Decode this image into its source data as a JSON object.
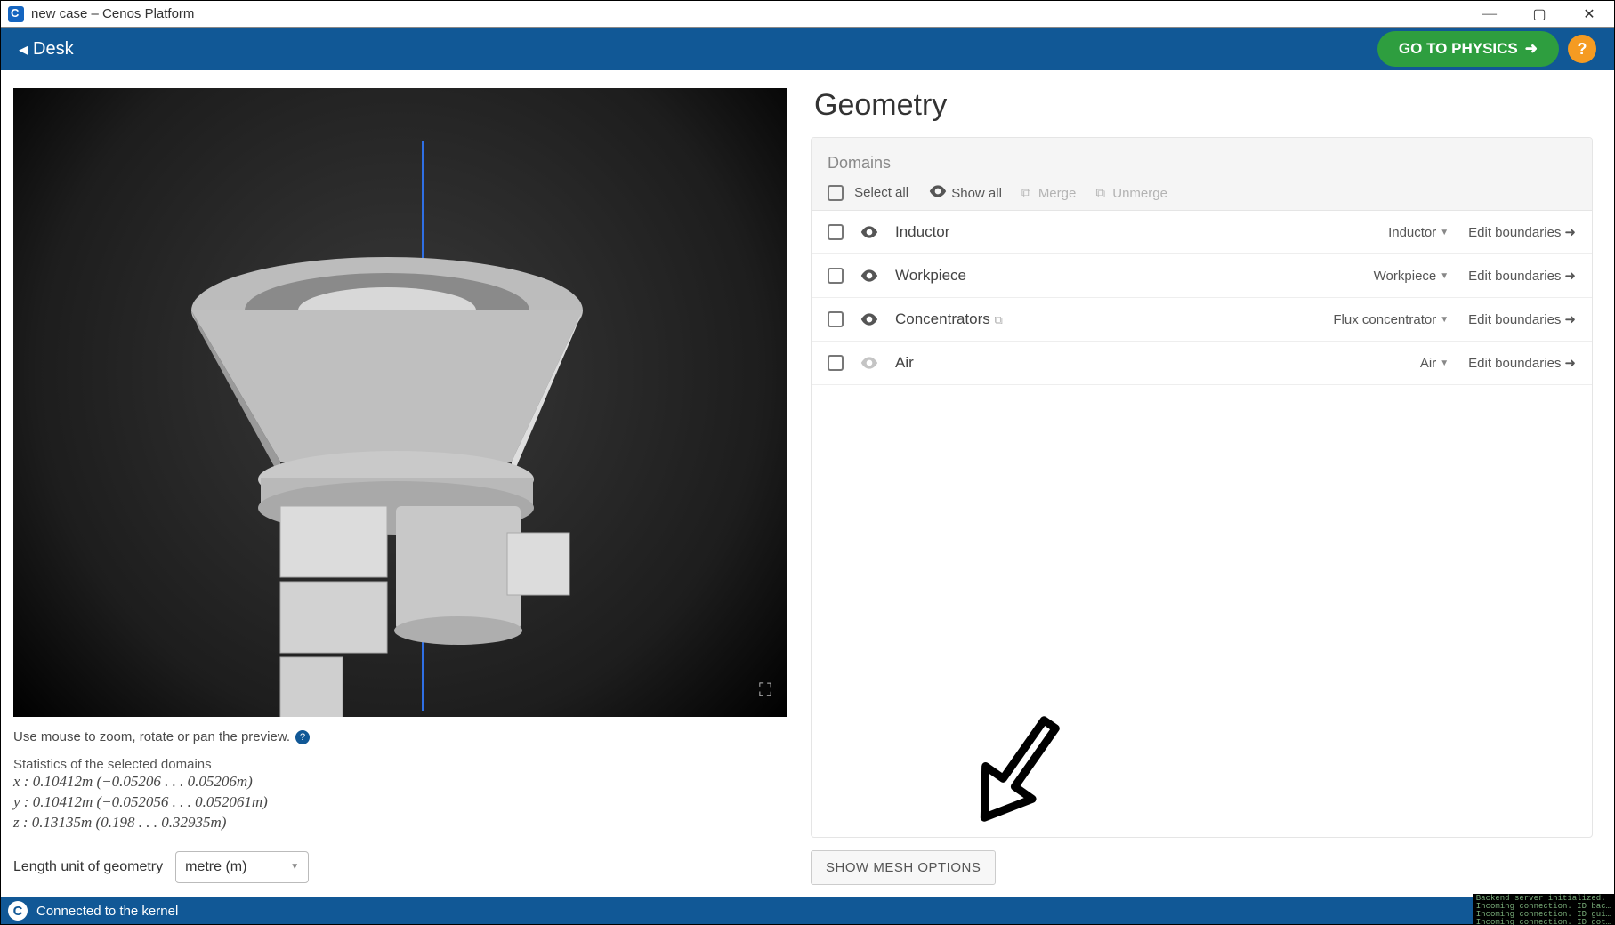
{
  "window": {
    "title": "new case – Cenos Platform"
  },
  "toolbar": {
    "desk_label": "Desk",
    "physics_label": "GO TO PHYSICS",
    "help_label": "?"
  },
  "viewport": {
    "hint": "Use mouse to zoom, rotate or pan the preview.",
    "stats_title": "Statistics of the selected domains",
    "stat_x": "x : 0.10412m (−0.05206 . . . 0.05206m)",
    "stat_y": "y : 0.10412m (−0.052056 . . . 0.052061m)",
    "stat_z": "z : 0.13135m (0.198 . . . 0.32935m)",
    "length_unit_label": "Length unit of geometry",
    "length_unit_value": "metre (m)"
  },
  "geometry": {
    "title": "Geometry",
    "domains_label": "Domains",
    "select_all": "Select all",
    "show_all": "Show all",
    "merge": "Merge",
    "unmerge": "Unmerge",
    "edit_label": "Edit boundaries",
    "rows": [
      {
        "name": "Inductor",
        "type": "Inductor",
        "visible": true
      },
      {
        "name": "Workpiece",
        "type": "Workpiece",
        "visible": true
      },
      {
        "name": "Concentrators",
        "type": "Flux concentrator",
        "visible": true,
        "copy_icon": true
      },
      {
        "name": "Air",
        "type": "Air",
        "visible": false
      }
    ],
    "mesh_button": "SHOW MESH OPTIONS"
  },
  "status": {
    "text": "Connected to the kernel",
    "log": "Backend server initialized.\nIncoming connection. ID bac…\nIncoming connection. ID gui…\nIncoming connection. ID got…"
  }
}
